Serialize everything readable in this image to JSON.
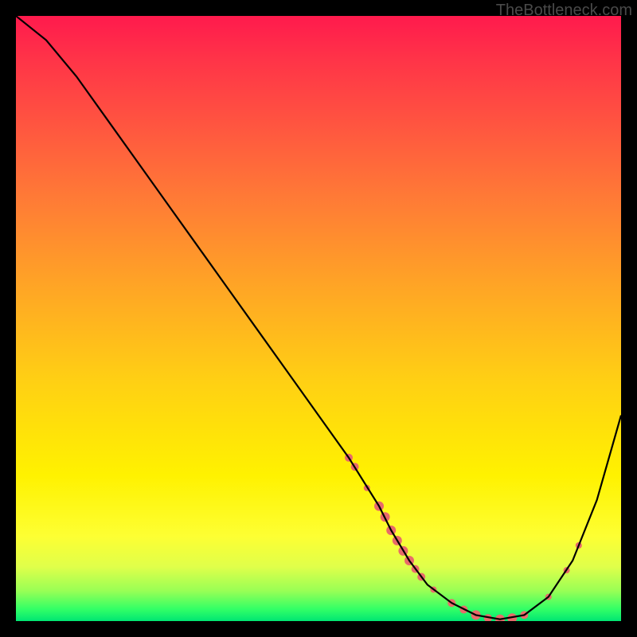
{
  "watermark": "TheBottleneck.com",
  "chart_data": {
    "type": "line",
    "title": "",
    "xlabel": "",
    "ylabel": "",
    "xlim": [
      0,
      100
    ],
    "ylim": [
      0,
      100
    ],
    "series": [
      {
        "name": "curve",
        "x": [
          0,
          5,
          10,
          15,
          20,
          25,
          30,
          35,
          40,
          45,
          50,
          55,
          60,
          62,
          65,
          68,
          72,
          76,
          80,
          84,
          88,
          92,
          96,
          100
        ],
        "y": [
          100,
          96,
          90,
          83,
          76,
          69,
          62,
          55,
          48,
          41,
          34,
          27,
          19,
          15,
          10,
          6,
          3,
          1,
          0.3,
          1,
          4,
          10,
          20,
          34
        ]
      }
    ],
    "markers": [
      {
        "x": 55,
        "y": 27,
        "r": 5
      },
      {
        "x": 56,
        "y": 25.5,
        "r": 5
      },
      {
        "x": 58,
        "y": 22,
        "r": 4
      },
      {
        "x": 60,
        "y": 19,
        "r": 6
      },
      {
        "x": 61,
        "y": 17.2,
        "r": 6
      },
      {
        "x": 62,
        "y": 15,
        "r": 6
      },
      {
        "x": 63,
        "y": 13.3,
        "r": 6
      },
      {
        "x": 64,
        "y": 11.6,
        "r": 6
      },
      {
        "x": 65,
        "y": 10,
        "r": 6
      },
      {
        "x": 66,
        "y": 8.6,
        "r": 5
      },
      {
        "x": 67,
        "y": 7.3,
        "r": 5
      },
      {
        "x": 69,
        "y": 5.2,
        "r": 4
      },
      {
        "x": 72,
        "y": 3,
        "r": 5
      },
      {
        "x": 74,
        "y": 1.9,
        "r": 5
      },
      {
        "x": 76,
        "y": 1,
        "r": 6
      },
      {
        "x": 78,
        "y": 0.5,
        "r": 5
      },
      {
        "x": 80,
        "y": 0.3,
        "r": 6
      },
      {
        "x": 82,
        "y": 0.5,
        "r": 6
      },
      {
        "x": 84,
        "y": 1,
        "r": 5
      },
      {
        "x": 88,
        "y": 4,
        "r": 4
      },
      {
        "x": 91,
        "y": 8.4,
        "r": 4
      },
      {
        "x": 93,
        "y": 12.5,
        "r": 4
      }
    ],
    "marker_color": "#e86a6a",
    "curve_color": "#000000"
  }
}
